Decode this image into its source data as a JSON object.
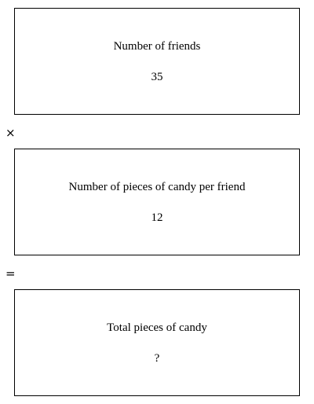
{
  "boxes": [
    {
      "label": "Number of friends",
      "value": "35"
    },
    {
      "label": "Number of pieces of candy per friend",
      "value": "12"
    },
    {
      "label": "Total pieces of candy",
      "value": "?"
    }
  ],
  "operators": [
    "×",
    "="
  ]
}
